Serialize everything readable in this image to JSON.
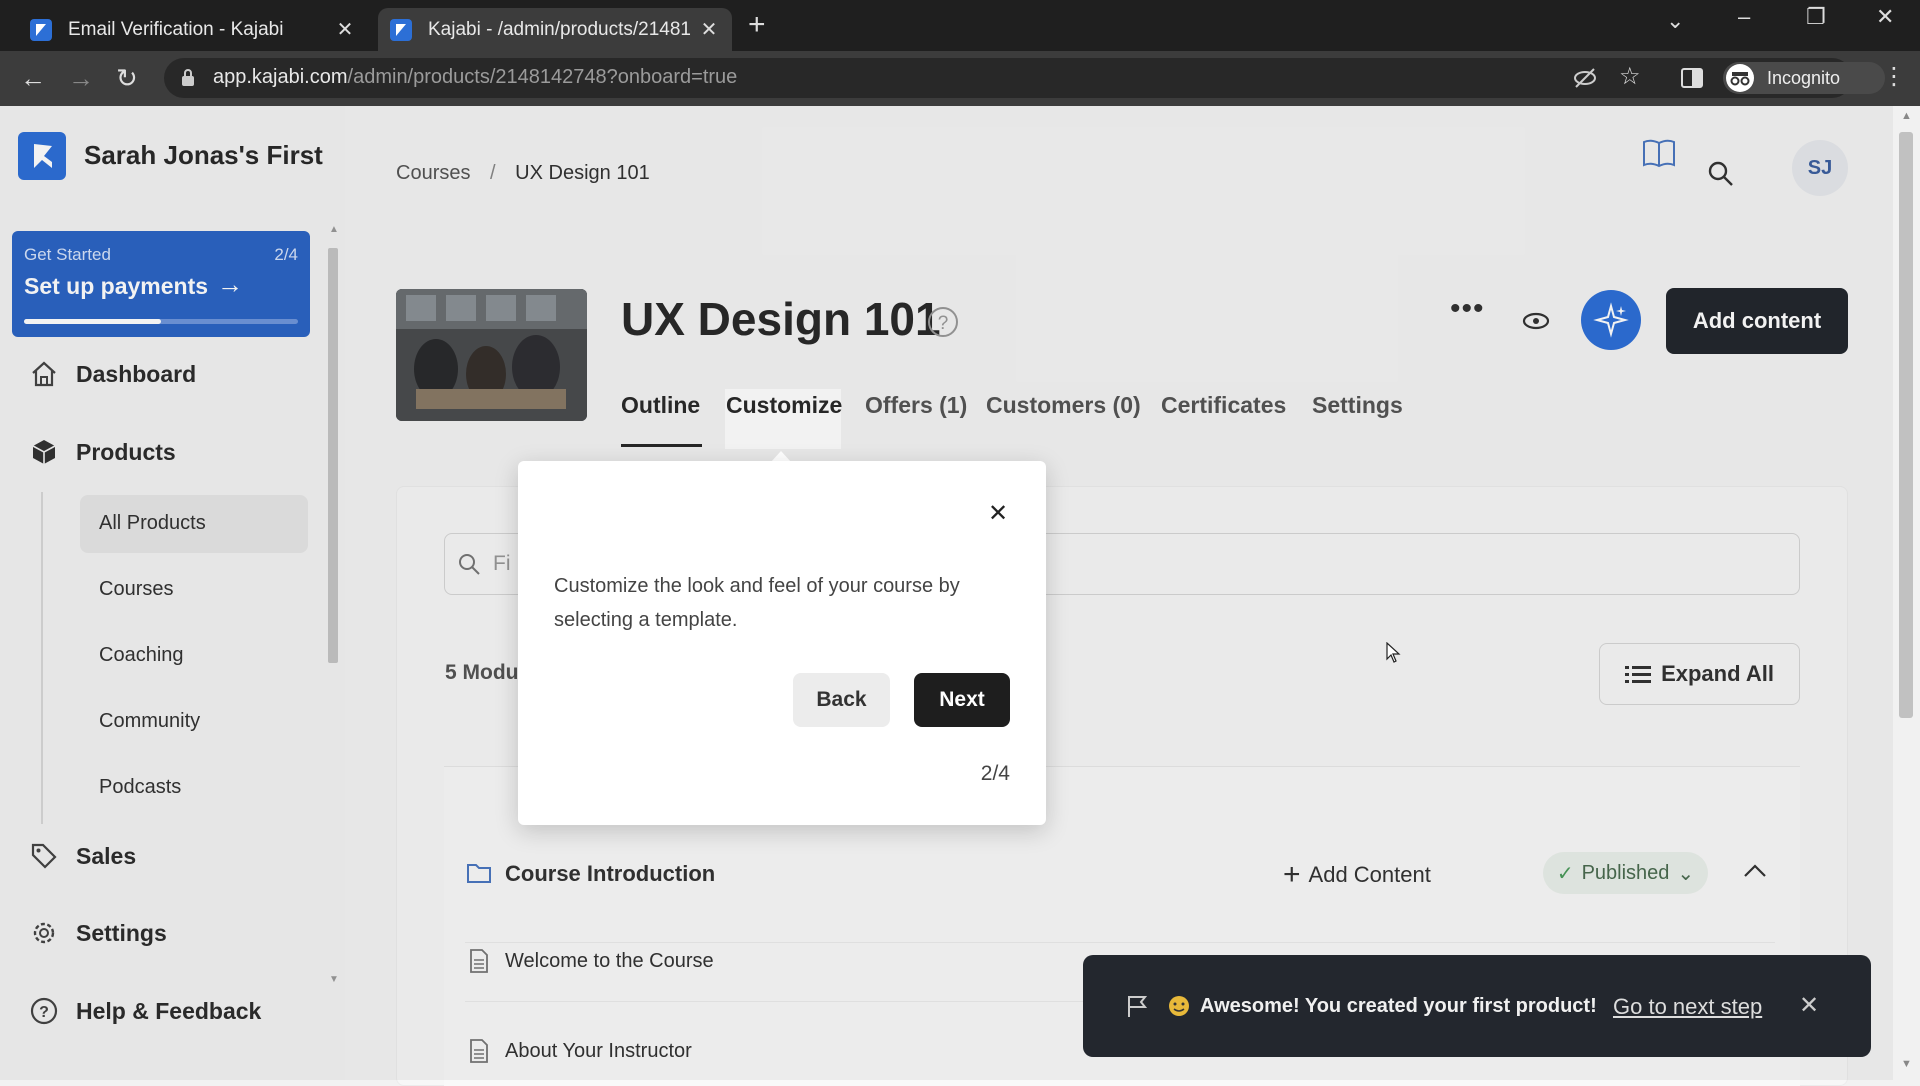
{
  "browser": {
    "tabs": [
      {
        "title": "Email Verification - Kajabi",
        "active": false
      },
      {
        "title": "Kajabi - /admin/products/21481",
        "active": true
      }
    ],
    "url_host": "app.kajabi.com",
    "url_path": "/admin/products/2148142748?onboard=true",
    "profile_label": "Incognito"
  },
  "sidebar": {
    "site_name": "Sarah Jonas's First",
    "get_started": {
      "label": "Get Started",
      "progress_text": "2/4",
      "action": "Set up payments",
      "progress": 0.5
    },
    "nav": [
      {
        "label": "Dashboard",
        "icon": "home-icon"
      },
      {
        "label": "Products",
        "icon": "box-icon"
      },
      {
        "label": "Sales",
        "icon": "tag-icon"
      },
      {
        "label": "Settings",
        "icon": "gear-icon"
      },
      {
        "label": "Help & Feedback",
        "icon": "help-icon"
      }
    ],
    "products_sub": [
      "All Products",
      "Courses",
      "Coaching",
      "Community",
      "Podcasts"
    ]
  },
  "header": {
    "breadcrumb": [
      "Courses",
      "UX Design 101"
    ],
    "avatar_initials": "SJ"
  },
  "product": {
    "title": "UX Design 101",
    "add_content_label": "Add content",
    "tabs": [
      "Outline",
      "Customize",
      "Offers (1)",
      "Customers (0)",
      "Certificates",
      "Settings"
    ],
    "search_placeholder": "Fi",
    "modules_count": "5 Modu",
    "expand_all_label": "Expand All",
    "module": {
      "title": "Course Introduction",
      "add_content_label": "Add Content",
      "status": "Published"
    },
    "lessons": [
      "Welcome to the Course",
      "About Your Instructor"
    ]
  },
  "popover": {
    "text": "Customize the look and feel of your course by selecting a template.",
    "back_label": "Back",
    "next_label": "Next",
    "step": "2/4"
  },
  "toast": {
    "message": "Awesome! You created your first product!",
    "link": "Go to next step"
  },
  "colors": {
    "accent": "#2e6fd7",
    "dark": "#23272e",
    "get_started_bg": "#2c65c4"
  }
}
